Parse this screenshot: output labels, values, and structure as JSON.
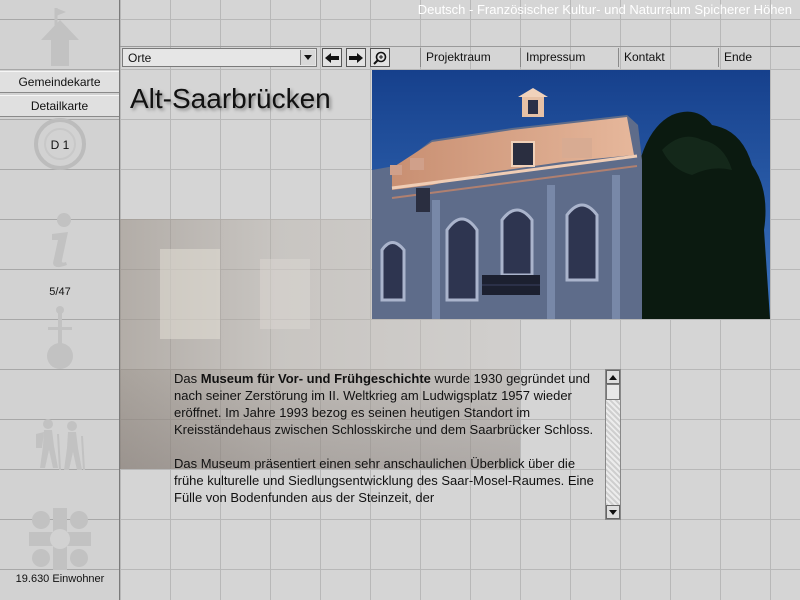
{
  "header": {
    "title": "Deutsch - Französischer Kultur- und Naturraum Spicherer Höhen"
  },
  "toolbar": {
    "dropdown_value": "Orte",
    "icons": [
      "arrow-left-icon",
      "arrow-right-icon",
      "magnifier-icon"
    ]
  },
  "nav": {
    "items": [
      "Projektraum",
      "Impressum",
      "Kontakt",
      "Ende"
    ]
  },
  "sidebar": {
    "buttons": [
      "Gemeindekarte",
      "Detailkarte"
    ],
    "map_code": "D 1",
    "page_counter": "5/47",
    "population": "19.630 Einwohner",
    "icons": [
      "up-arrow-icon",
      "circle-icon",
      "info-icon",
      "map-pin-icon",
      "hikers-icon",
      "coat-of-arms-icon"
    ]
  },
  "main": {
    "title": "Alt-Saarbrücken",
    "paragraph1": {
      "pre": "Das ",
      "bold": "Museum für Vor- und Frühgeschichte",
      "post": " wurde 1930 gegründet und nach seiner Zerstörung im II. Weltkrieg am Ludwigsplatz 1957 wieder eröffnet. Im Jahre 1993 bezog es seinen heutigen Standort im Kreisständehaus zwischen Schlosskirche und dem Saarbrücker Schloss."
    },
    "paragraph2": "Das Museum präsentiert einen sehr anschaulichen Überblick über die frühe kulturelle und Siedlungsentwicklung des Saar-Mosel-Raumes. Eine Fülle von Bodenfunden aus der Steinzeit, der"
  },
  "colors": {
    "background": "#d5d5d5",
    "sky": "#2a5aa0",
    "building_lit": "#d8a382"
  }
}
